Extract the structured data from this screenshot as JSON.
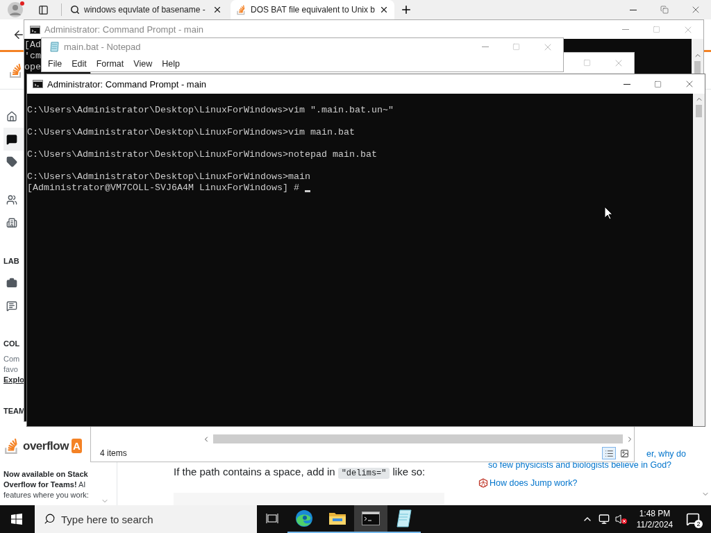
{
  "browser": {
    "tabs": [
      {
        "label": "windows equvlate of basename -",
        "kind": "search",
        "selected": false
      },
      {
        "label": "DOS BAT file equivalent to Unix b",
        "kind": "site",
        "selected": true
      }
    ],
    "sidebar": {
      "nav": [
        {
          "kind": "home",
          "selected": false
        },
        {
          "kind": "questions",
          "selected": true
        },
        {
          "kind": "tags",
          "selected": false
        },
        {
          "kind": "users",
          "selected": false
        },
        {
          "kind": "companies",
          "selected": false
        }
      ],
      "labs_heading": "LAB",
      "labs": [
        {
          "kind": "jobs",
          "selected": false
        },
        {
          "kind": "discussions",
          "selected": false
        }
      ],
      "collectives_heading": "COL",
      "collectives_text": [
        "Com",
        "favo"
      ],
      "collectives_link": "Explo",
      "teams_heading": "TEAM",
      "ad": {
        "logo_text": "overflow",
        "logo_badge": "A",
        "text": "**Now available on Stack Overflow for Teams!** AI features where you work:"
      }
    },
    "article": {
      "text_before": "If the path contains a space, add in",
      "code": "\"delims=\"",
      "text_after": "like so:"
    },
    "hot_questions": [
      {
        "kind": "plain",
        "lines": [
          "er, why do",
          "so few physicists and biologists believe in God?"
        ]
      },
      {
        "kind": "site",
        "lines": [
          "How does Jump work?"
        ]
      }
    ]
  },
  "back_cmd": {
    "title": "Administrator: Command Prompt - main",
    "lines": [
      "[Ad",
      "'cm",
      "ope"
    ]
  },
  "explorer": {
    "status": "4 items",
    "views": [
      {
        "kind": "details",
        "selected": true
      },
      {
        "kind": "large_icons",
        "selected": false
      }
    ]
  },
  "notepad": {
    "title": "main.bat - Notepad",
    "menu": [
      "File",
      "Edit",
      "Format",
      "View",
      "Help"
    ]
  },
  "front_cmd": {
    "title": "Administrator: Command Prompt - main",
    "lines": [
      {
        "text": "C:\\Users\\Administrator\\Desktop\\LinuxForWindows>vim \".main.bat.un~\"",
        "blank_after": true
      },
      {
        "text": "C:\\Users\\Administrator\\Desktop\\LinuxForWindows>vim main.bat",
        "blank_after": true
      },
      {
        "text": "C:\\Users\\Administrator\\Desktop\\LinuxForWindows>notepad main.bat",
        "blank_after": true
      },
      {
        "text": "C:\\Users\\Administrator\\Desktop\\LinuxForWindows>main",
        "blank_after": false
      }
    ],
    "prompt": "[Administrator@VM7COLL-SVJ6A4M LinuxForWindows] #"
  },
  "taskbar": {
    "search": {
      "placeholder": "Type here to search"
    },
    "apps": [
      {
        "kind": "edge",
        "selected": false
      },
      {
        "kind": "folder",
        "selected": false
      },
      {
        "kind": "terminal",
        "selected": true
      },
      {
        "kind": "notepad",
        "selected": false
      }
    ],
    "time": "1:48 PM",
    "date": "11/2/2024",
    "notifications": "2"
  }
}
